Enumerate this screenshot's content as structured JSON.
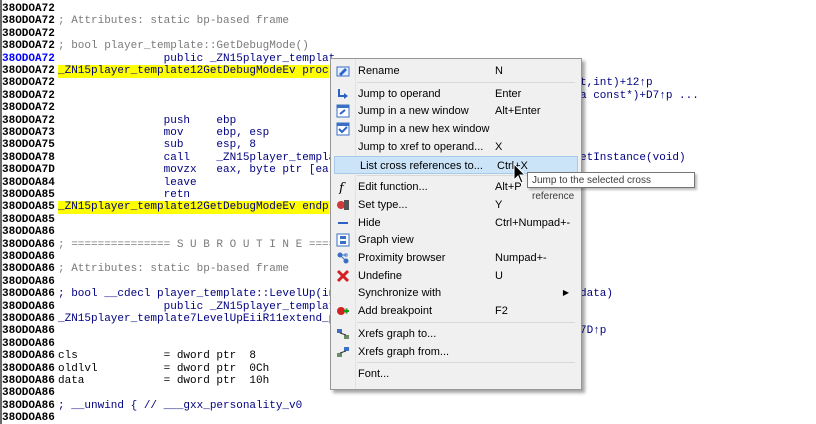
{
  "listing": {
    "lines": [
      {
        "addr": "38ODOA72",
        "text": "",
        "cls": "cmt"
      },
      {
        "addr": "38ODOA72",
        "text": "; Attributes: static bp-based frame",
        "cls": "cmt"
      },
      {
        "addr": "38ODOA72",
        "text": "",
        "cls": "cmt"
      },
      {
        "addr": "38ODOA72",
        "text": "; bool player_template::GetDebugMode()",
        "cls": "cmt"
      },
      {
        "addr": "38ODOA72",
        "text": "                public _ZN15player_templat",
        "cls": "kw",
        "current": true
      },
      {
        "addr": "38ODOA72",
        "text": "_ZN15player_template12GetDebugModeEv proc",
        "cls": "lbl"
      },
      {
        "addr": "38ODOA72",
        "text": "",
        "cls": "cmt",
        "tail": "t,int)+12↑p"
      },
      {
        "addr": "38ODOA72",
        "text": "",
        "cls": "cmt",
        "tail": "a const*)+D7↑p ..."
      },
      {
        "addr": "38ODOA72",
        "text": "",
        "cls": "cmt"
      },
      {
        "addr": "38ODOA72",
        "text": "                push    ebp",
        "cls": "ins"
      },
      {
        "addr": "38ODOA73",
        "text": "                mov     ebp, esp",
        "cls": "ins"
      },
      {
        "addr": "38ODOA75",
        "text": "                sub     esp, 8",
        "cls": "ins"
      },
      {
        "addr": "38ODOA78",
        "text": "                call    _ZN15player_templa",
        "cls": "ins",
        "tail": "etInstance(void)"
      },
      {
        "addr": "38ODOA7D",
        "text": "                movzx   eax, byte ptr [ea",
        "cls": "ins"
      },
      {
        "addr": "38ODOA84",
        "text": "                leave",
        "cls": "ins"
      },
      {
        "addr": "38ODOA85",
        "text": "                retn",
        "cls": "ins"
      },
      {
        "addr": "38ODOA85",
        "text": "_ZN15player_template12GetDebugModeEv endp",
        "cls": "lbl"
      },
      {
        "addr": "38ODOA85",
        "text": "",
        "cls": "cmt"
      },
      {
        "addr": "38ODOA86",
        "text": "",
        "cls": "cmt"
      },
      {
        "addr": "38ODOA86",
        "text": "; =============== S U B R O U T I N E ====",
        "cls": "cmt"
      },
      {
        "addr": "38ODOA86",
        "text": "",
        "cls": "cmt"
      },
      {
        "addr": "38ODOA86",
        "text": "; Attributes: static bp-based frame",
        "cls": "cmt"
      },
      {
        "addr": "38ODOA86",
        "text": "",
        "cls": "cmt"
      },
      {
        "addr": "38ODOA86",
        "text": "; bool __cdecl player_template::LevelUp(in",
        "cls": "kw",
        "tail": "data)"
      },
      {
        "addr": "38ODOA86",
        "text": "                public _ZN15player_templat",
        "cls": "kw"
      },
      {
        "addr": "38ODOA86",
        "text": "_ZN15player_template7LevelUpEiiR11extend_p",
        "cls": "kw"
      },
      {
        "addr": "38ODOA86",
        "text": "",
        "cls": "cmt",
        "tail": "7D↑p"
      },
      {
        "addr": "38ODOA86",
        "text": "",
        "cls": "cmt"
      },
      {
        "addr": "38ODOA86",
        "text": "cls             = dword ptr  8",
        "cls": "var"
      },
      {
        "addr": "38ODOA86",
        "text": "oldlvl          = dword ptr  0Ch",
        "cls": "var"
      },
      {
        "addr": "38ODOA86",
        "text": "data            = dword ptr  10h",
        "cls": "var"
      },
      {
        "addr": "38ODOA86",
        "text": "",
        "cls": "cmt"
      },
      {
        "addr": "38ODOA86",
        "text": "; __unwind { // ___gxx_personality_v0",
        "cls": "kw"
      },
      {
        "addr": "38ODOA86",
        "text": "",
        "cls": "cmt"
      }
    ]
  },
  "context_menu": {
    "items": [
      {
        "type": "item",
        "name": "rename",
        "icon": "rename-icon",
        "label": "Rename",
        "shortcut": "N"
      },
      {
        "type": "sep"
      },
      {
        "type": "item",
        "name": "jump-to-operand",
        "icon": "jump-arrow-icon",
        "label": "Jump to operand",
        "shortcut": "Enter"
      },
      {
        "type": "item",
        "name": "jump-new-window",
        "icon": "new-window-icon",
        "label": "Jump in a new window",
        "shortcut": "Alt+Enter"
      },
      {
        "type": "item",
        "name": "jump-new-hex-window",
        "icon": "hex-window-icon",
        "label": "Jump in a new hex window",
        "shortcut": ""
      },
      {
        "type": "item",
        "name": "jump-xref-operand",
        "icon": "",
        "label": "Jump to xref to operand...",
        "shortcut": "X"
      },
      {
        "type": "item",
        "name": "list-cross-references",
        "icon": "",
        "label": "List cross references to...",
        "shortcut": "Ctrl+X",
        "highlight": true
      },
      {
        "type": "sep"
      },
      {
        "type": "item",
        "name": "edit-function",
        "icon": "function-icon",
        "label": "Edit function...",
        "shortcut": "Alt+P"
      },
      {
        "type": "item",
        "name": "set-type",
        "icon": "set-type-icon",
        "label": "Set type...",
        "shortcut": "Y"
      },
      {
        "type": "item",
        "name": "hide",
        "icon": "hide-icon",
        "label": "Hide",
        "shortcut": "Ctrl+Numpad+-"
      },
      {
        "type": "item",
        "name": "graph-view",
        "icon": "graph-view-icon",
        "label": "Graph view",
        "shortcut": ""
      },
      {
        "type": "item",
        "name": "proximity-browser",
        "icon": "proximity-icon",
        "label": "Proximity browser",
        "shortcut": "Numpad+-"
      },
      {
        "type": "item",
        "name": "undefine",
        "icon": "undefine-icon",
        "label": "Undefine",
        "shortcut": "U"
      },
      {
        "type": "item",
        "name": "synchronize-with",
        "icon": "",
        "label": "Synchronize with",
        "shortcut": "",
        "submenu": true
      },
      {
        "type": "item",
        "name": "add-breakpoint",
        "icon": "breakpoint-icon",
        "label": "Add breakpoint",
        "shortcut": "F2"
      },
      {
        "type": "sep"
      },
      {
        "type": "item",
        "name": "xrefs-graph-to",
        "icon": "xrefs-to-icon",
        "label": "Xrefs graph to...",
        "shortcut": ""
      },
      {
        "type": "item",
        "name": "xrefs-graph-from",
        "icon": "xrefs-from-icon",
        "label": "Xrefs graph from...",
        "shortcut": ""
      },
      {
        "type": "sep"
      },
      {
        "type": "item",
        "name": "font",
        "icon": "",
        "label": "Font...",
        "shortcut": ""
      }
    ]
  },
  "tooltip": {
    "text": "Jump to the selected cross reference"
  },
  "colors": {
    "label_highlight": "#ffff00",
    "address_current": "#0000ff",
    "comment": "#7a7a7a",
    "menu_highlight": "#cce4f7"
  }
}
